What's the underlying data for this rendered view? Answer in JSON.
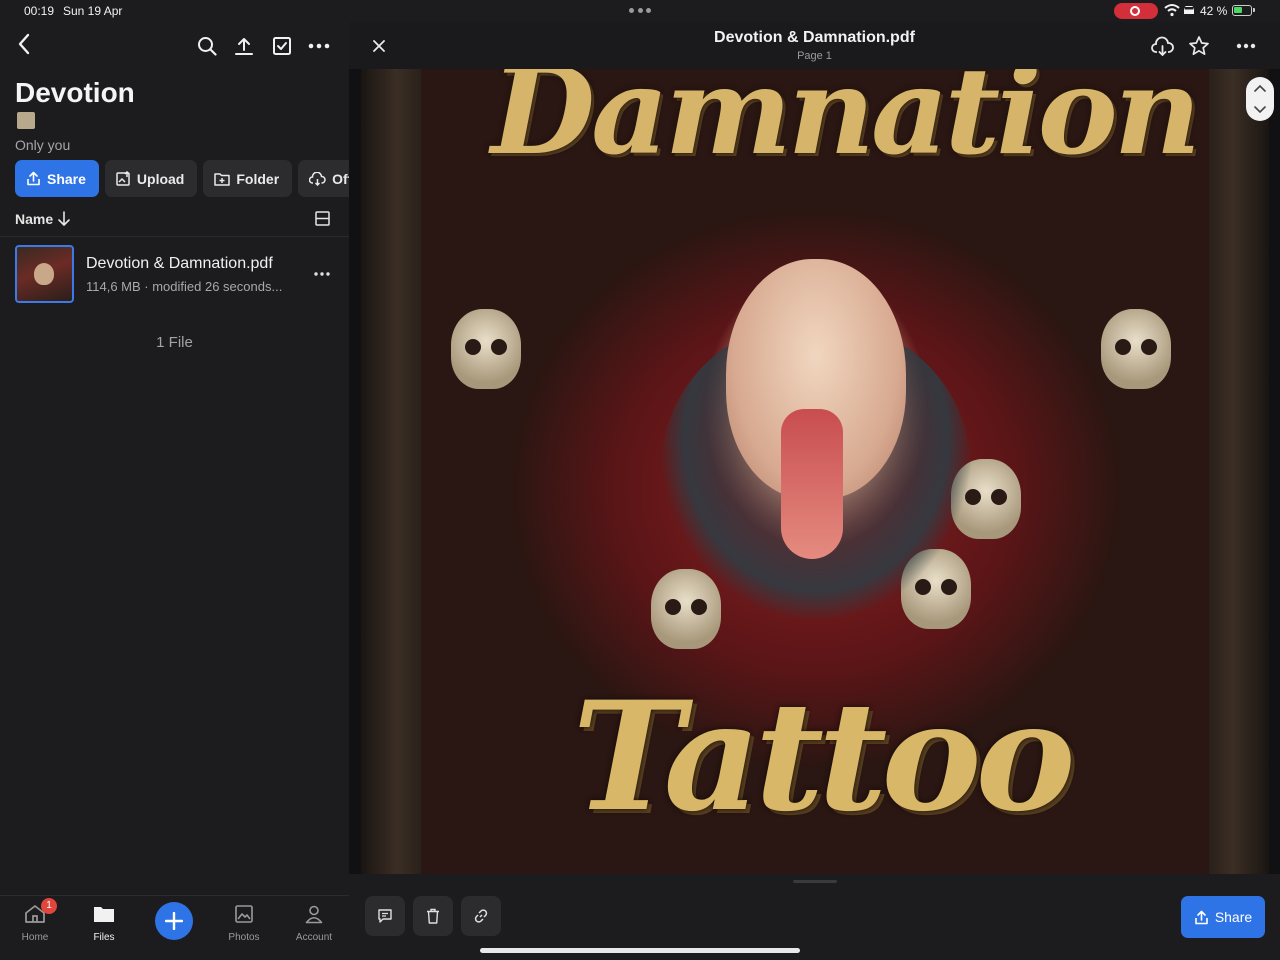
{
  "status_bar": {
    "time": "00:19",
    "date": "Sun 19 Apr",
    "battery_percent": "42 %",
    "battery_level": 0.42
  },
  "sidebar": {
    "folder_title": "Devotion",
    "owner": "Only you",
    "actions": [
      "Share",
      "Upload",
      "Folder",
      "Offline"
    ],
    "sort_label": "Name",
    "files": [
      {
        "name": "Devotion & Damnation.pdf",
        "meta": "114,6 MB · modified 26 seconds..."
      }
    ],
    "file_count": "1 File"
  },
  "tabbar": {
    "home": "Home",
    "home_badge": "1",
    "files": "Files",
    "photos": "Photos",
    "account": "Account"
  },
  "viewer": {
    "title": "Devotion & Damnation.pdf",
    "page_label": "Page 1",
    "art_top_text": "Damnation",
    "art_bottom_text": "Tattoo",
    "share_label": "Share"
  },
  "colors": {
    "accent": "#2f74e6",
    "background": "#1c1c1e",
    "badge": "#e0463c",
    "recording": "#d32f3a"
  }
}
